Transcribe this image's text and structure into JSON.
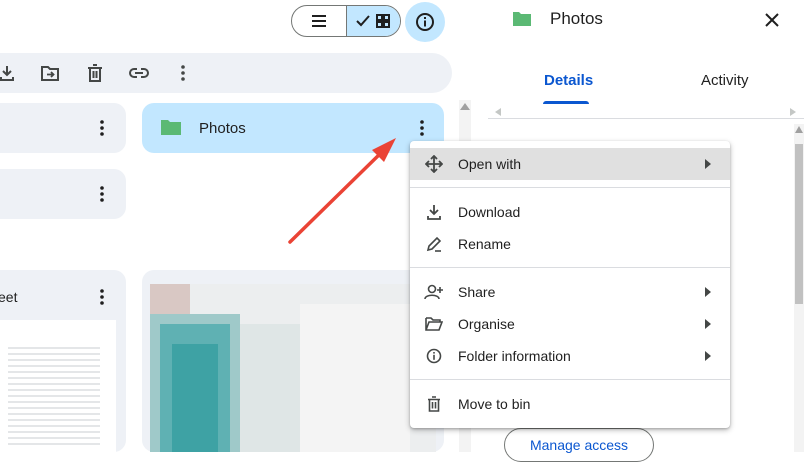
{
  "panel": {
    "title": "Photos",
    "tabs": [
      {
        "label": "Details",
        "active": true
      },
      {
        "label": "Activity",
        "active": false
      }
    ],
    "manage_access_label": "Manage access"
  },
  "cards": {
    "selected_folder_label": "Photos",
    "partial_file_label": "eet"
  },
  "toolbar": {
    "icons": [
      "download-icon",
      "move-to-folder-icon",
      "delete-icon",
      "link-icon",
      "more-vert-icon"
    ]
  },
  "view_toggle": {
    "options": [
      "list-view-icon",
      "grid-view-icon"
    ],
    "selected": "grid-view-icon"
  },
  "context_menu": {
    "items": [
      {
        "label": "Open with",
        "icon": "move-arrows-icon",
        "submenu": true,
        "hovered": true
      },
      {
        "label": "Download",
        "icon": "download-icon",
        "submenu": false
      },
      {
        "label": "Rename",
        "icon": "rename-pencil-icon",
        "submenu": false
      },
      {
        "label": "Share",
        "icon": "person-add-icon",
        "submenu": true
      },
      {
        "label": "Organise",
        "icon": "folder-open-icon",
        "submenu": true
      },
      {
        "label": "Folder information",
        "icon": "info-icon",
        "submenu": true
      },
      {
        "label": "Move to bin",
        "icon": "trash-icon",
        "submenu": false
      }
    ]
  },
  "colors": {
    "selected_bg": "#c2e7ff",
    "card_bg": "#eef1f6",
    "accent_blue": "#0b57d0",
    "folder_green": "#5bb974",
    "annotation_red": "#ea4335"
  }
}
